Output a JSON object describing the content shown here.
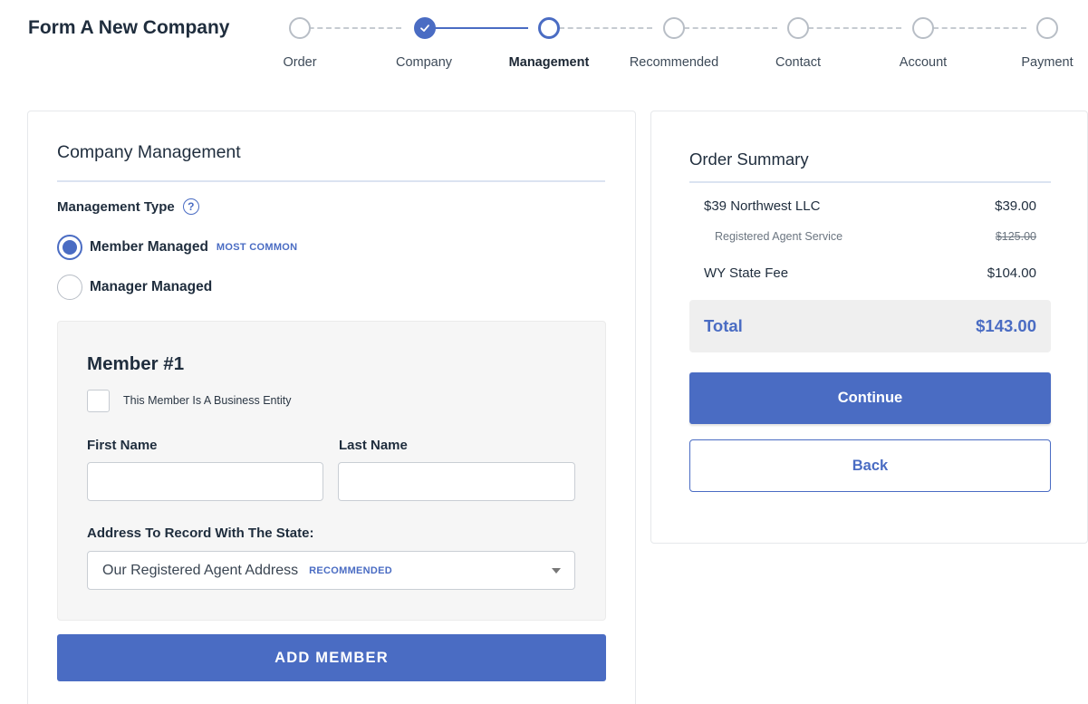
{
  "header": {
    "title": "Form A New Company"
  },
  "stepper": {
    "steps": [
      {
        "label": "Order",
        "state": "pending"
      },
      {
        "label": "Company",
        "state": "done"
      },
      {
        "label": "Management",
        "state": "active"
      },
      {
        "label": "Recommended",
        "state": "pending"
      },
      {
        "label": "Contact",
        "state": "pending"
      },
      {
        "label": "Account",
        "state": "pending"
      },
      {
        "label": "Payment",
        "state": "pending"
      }
    ]
  },
  "management": {
    "title": "Company Management",
    "type_label": "Management Type",
    "help_icon": "?",
    "options": [
      {
        "label": "Member Managed",
        "badge": "MOST COMMON",
        "selected": true
      },
      {
        "label": "Manager Managed",
        "selected": false
      }
    ]
  },
  "member": {
    "title": "Member #1",
    "business_entity_label": "This Member Is A Business Entity",
    "first_name_label": "First Name",
    "first_name_value": "",
    "last_name_label": "Last Name",
    "last_name_value": "",
    "address_label": "Address To Record With The State:",
    "address_value": "Our Registered Agent Address",
    "address_badge": "RECOMMENDED"
  },
  "add_member_button": "ADD MEMBER",
  "summary": {
    "title": "Order Summary",
    "items": [
      {
        "name": "$39 Northwest LLC",
        "price": "$39.00"
      },
      {
        "name": "Registered Agent Service",
        "price": "$125.00",
        "struck": true
      },
      {
        "name": "WY State Fee",
        "price": "$104.00"
      }
    ],
    "total_label": "Total",
    "total_value": "$143.00",
    "continue_label": "Continue",
    "back_label": "Back"
  },
  "colors": {
    "accent": "#4a6cc3",
    "text": "#1f2d3d",
    "panel": "#f6f6f6"
  }
}
